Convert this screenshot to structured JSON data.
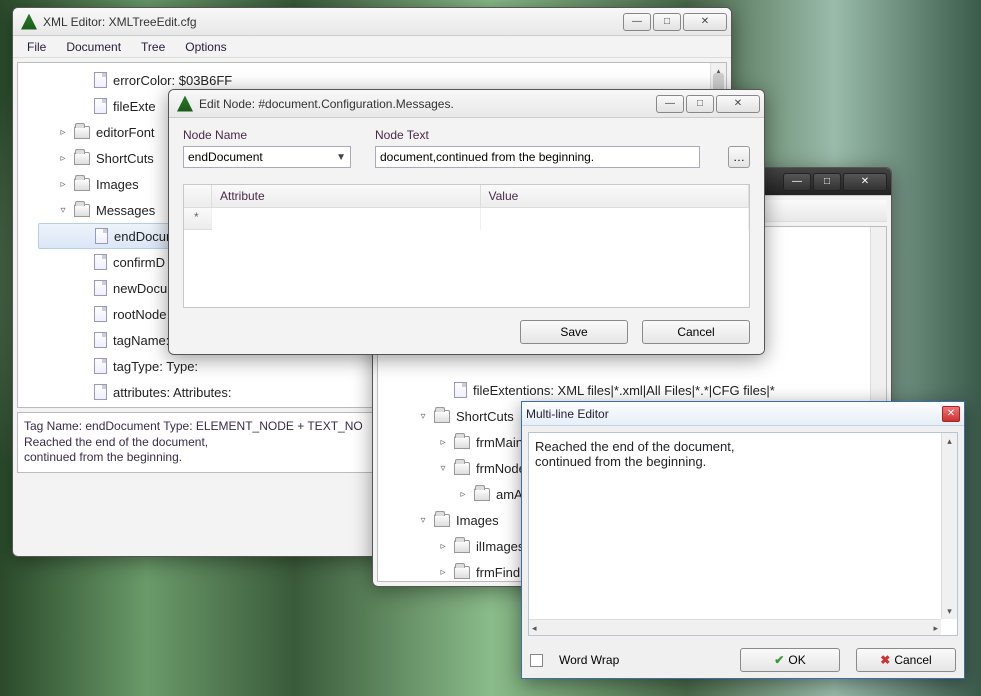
{
  "main_window": {
    "title": "XML Editor: XMLTreeEdit.cfg",
    "menu": [
      "File",
      "Document",
      "Tree",
      "Options"
    ],
    "tree": {
      "items": [
        {
          "label": "errorColor: $03B6FF",
          "icon": "file",
          "depth": 2
        },
        {
          "label": "fileExte",
          "icon": "file",
          "depth": 2
        },
        {
          "label": "editorFont",
          "icon": "folder",
          "exp": "▹",
          "depth": 1
        },
        {
          "label": "ShortCuts",
          "icon": "folder",
          "exp": "▹",
          "depth": 1
        },
        {
          "label": "Images",
          "icon": "folder",
          "exp": "▹",
          "depth": 1
        },
        {
          "label": "Messages",
          "icon": "folder",
          "exp": "▿",
          "depth": 1
        },
        {
          "label": "endDocume",
          "icon": "file",
          "depth": 2,
          "selected": true
        },
        {
          "label": "confirmD",
          "icon": "file",
          "depth": 2
        },
        {
          "label": "newDocume",
          "icon": "file",
          "depth": 2
        },
        {
          "label": "rootNode",
          "icon": "file",
          "depth": 2
        },
        {
          "label": "tagName:",
          "icon": "file",
          "depth": 2
        },
        {
          "label": "tagType: Type:",
          "icon": "file",
          "depth": 2
        },
        {
          "label": "attributes: Attributes:",
          "icon": "file",
          "depth": 2
        }
      ]
    },
    "status": {
      "l1": "Tag Name: endDocument  Type: ELEMENT_NODE + TEXT_NO",
      "l2": "Reached the end of the document,",
      "l3": "continued from the beginning."
    }
  },
  "second_window": {
    "tree": [
      {
        "label": "fileExtentions: XML files|*.xml|All Files|*.*|CFG files|*",
        "icon": "file",
        "depth": 2
      },
      {
        "label": "ShortCuts",
        "icon": "folder",
        "exp": "▿",
        "depth": 1
      },
      {
        "label": "frmMain",
        "icon": "folder",
        "exp": "▹",
        "depth": 2
      },
      {
        "label": "frmNode",
        "icon": "folder",
        "exp": "▿",
        "depth": 2
      },
      {
        "label": "amActions",
        "icon": "folder",
        "exp": "▹",
        "depth": 3
      },
      {
        "label": "Images",
        "icon": "folder",
        "exp": "▿",
        "depth": 1
      },
      {
        "label": "ilImages",
        "icon": "folder",
        "exp": "▹",
        "depth": 2
      },
      {
        "label": "frmFind",
        "icon": "folder",
        "exp": "▹",
        "depth": 2
      }
    ]
  },
  "edit_dialog": {
    "title": "Edit Node: #document.Configuration.Messages.",
    "node_name_label": "Node Name",
    "node_text_label": "Node Text",
    "node_name_value": "endDocument",
    "node_text_value": "document,continued from the beginning.",
    "col_attr": "Attribute",
    "col_val": "Value",
    "save": "Save",
    "cancel": "Cancel"
  },
  "mle": {
    "title": "Multi-line Editor",
    "line1": "Reached the end of the document,",
    "line2": "continued from the beginning.",
    "wordwrap": "Word Wrap",
    "ok": "OK",
    "cancel": "Cancel"
  }
}
